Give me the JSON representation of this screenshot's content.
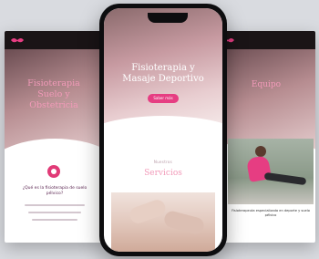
{
  "left_screen": {
    "hero_title": "Fisioterapia\nSuelo y\nObstetricia",
    "question": "¿Qué es la fisioterapia de suelo pélvico?",
    "pin_icon": "location-pin-icon"
  },
  "phone_screen": {
    "hero_title": "Fisioterapia y\nMasaje Deportivo",
    "cta_label": "Saber más",
    "section_eyebrow": "Nuestros",
    "section_title": "Servicios"
  },
  "right_screen": {
    "hero_title": "Equipo",
    "caption": "Fisioterapeuta especializada en deporte y suelo pélvico"
  },
  "colors": {
    "accent": "#e63d82",
    "title_pink": "#f29ab9",
    "background": "#d9dbe0",
    "phone_frame": "#0d0d0f"
  }
}
